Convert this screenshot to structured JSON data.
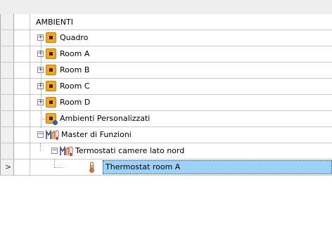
{
  "tree": {
    "header": "AMBIENTI",
    "rows": [
      {
        "label": "Quadro",
        "icon": "room-icon",
        "expander": "+"
      },
      {
        "label": "Room A",
        "icon": "room-icon",
        "expander": "+"
      },
      {
        "label": "Room B",
        "icon": "room-icon",
        "expander": "+"
      },
      {
        "label": "Room C",
        "icon": "room-icon",
        "expander": "+"
      },
      {
        "label": "Room D",
        "icon": "room-icon",
        "expander": "+"
      },
      {
        "label": "Ambienti Personalizzati",
        "icon": "custom-rooms-icon"
      },
      {
        "label": "Master di Funzioni",
        "icon": "function-master-icon",
        "expander": "−"
      },
      {
        "label": "Termostati camere lato nord",
        "icon": "function-master-icon",
        "expander": "−"
      },
      {
        "label": "Thermostat room A",
        "icon": "thermometer-icon",
        "selected": true
      }
    ],
    "row_indicator": ">"
  },
  "colors": {
    "room_icon": "#f5a623",
    "selection": "#9dd2f8"
  }
}
